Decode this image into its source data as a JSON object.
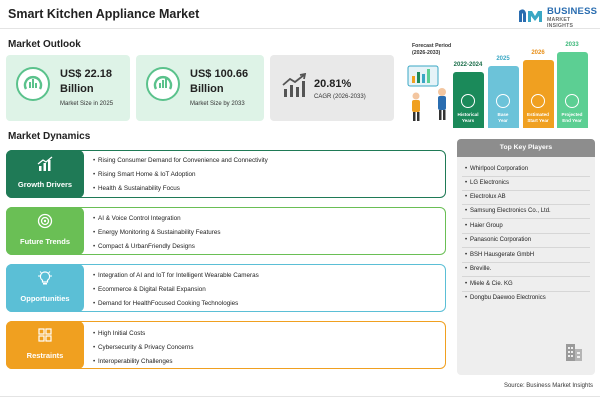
{
  "header": {
    "title": "Smart Kitchen Appliance Market",
    "logo_line1": "BUSINESS",
    "logo_line2": "MARKET INSIGHTS"
  },
  "outlook": {
    "section_title": "Market Outlook",
    "cards": [
      {
        "value": "US$ 22.18",
        "value2": "Billion",
        "caption": "Market Size in 2025"
      },
      {
        "value": "US$ 100.66",
        "value2": "Billion",
        "caption": "Market Size by 2033"
      },
      {
        "value": "20.81%",
        "caption": "CAGR (2026-2033)"
      }
    ]
  },
  "forecast": {
    "title_line1": "Forecast Period",
    "title_line2": "(2026-2033)",
    "bars": [
      {
        "label": "2022-2024",
        "caption_line1": "Historical",
        "caption_line2": "Years",
        "color": "#1b8a5a",
        "label_color": "#1b6e4a",
        "icon": "history-icon"
      },
      {
        "label": "2025",
        "caption_line1": "Base",
        "caption_line2": "Year",
        "color": "#6cc3d9",
        "label_color": "#3aa7c4",
        "icon": "calendar-icon"
      },
      {
        "label": "2026",
        "caption_line1": "Estimated",
        "caption_line2": "Start Year",
        "color": "#f0a020",
        "label_color": "#e8901a",
        "icon": "calculator-icon"
      },
      {
        "label": "2033",
        "caption_line1": "Projected",
        "caption_line2": "End Year",
        "color": "#5ccf93",
        "label_color": "#3db87a",
        "icon": "chart-growth-icon"
      }
    ]
  },
  "dynamics": {
    "section_title": "Market Dynamics",
    "groups": [
      {
        "label": "Growth Drivers",
        "color": "#1f7a56",
        "border": "#1f7a56",
        "icon": "growth-chart-icon",
        "items": [
          "Rising Consumer Demand for Convenience and Connectivity",
          "Rising Smart Home & IoT Adoption",
          "Health & Sustainability Focus"
        ]
      },
      {
        "label": "Future Trends",
        "color": "#6abf55",
        "border": "#6abf55",
        "icon": "target-icon",
        "items": [
          "AI & Voice Control Integration",
          "Energy Monitoring & Sustainability Features",
          "Compact & UrbanFriendly Designs"
        ]
      },
      {
        "label": "Opportunities",
        "color": "#5bbfd6",
        "border": "#5bbfd6",
        "icon": "lightbulb-icon",
        "items": [
          "Integration of AI and IoT for Intelligent Wearable Cameras",
          "Ecommerce & Digital Retail Expansion",
          "Demand for HealthFocused Cooking Technologies"
        ]
      },
      {
        "label": "Restraints",
        "color": "#f0a020",
        "border": "#f0a020",
        "icon": "puzzle-icon",
        "items": [
          "High Initial Costs",
          "Cybersecurity & Privacy Concerns",
          "Interoperability Challenges"
        ]
      }
    ]
  },
  "players": {
    "title": "Top Key Players",
    "items": [
      "Whirlpool Corporation",
      "LG Electronics",
      "Electrolux AB",
      "Samsung Electronics Co., Ltd.",
      "Haier Group",
      "Panasonic Corporation",
      "BSH Hausgerate GmbH",
      "Breville.",
      "Miele & Cie. KG",
      "Dongbu Daewoo Electronics"
    ]
  },
  "footer": {
    "source": "Source: Business Market Insights"
  }
}
